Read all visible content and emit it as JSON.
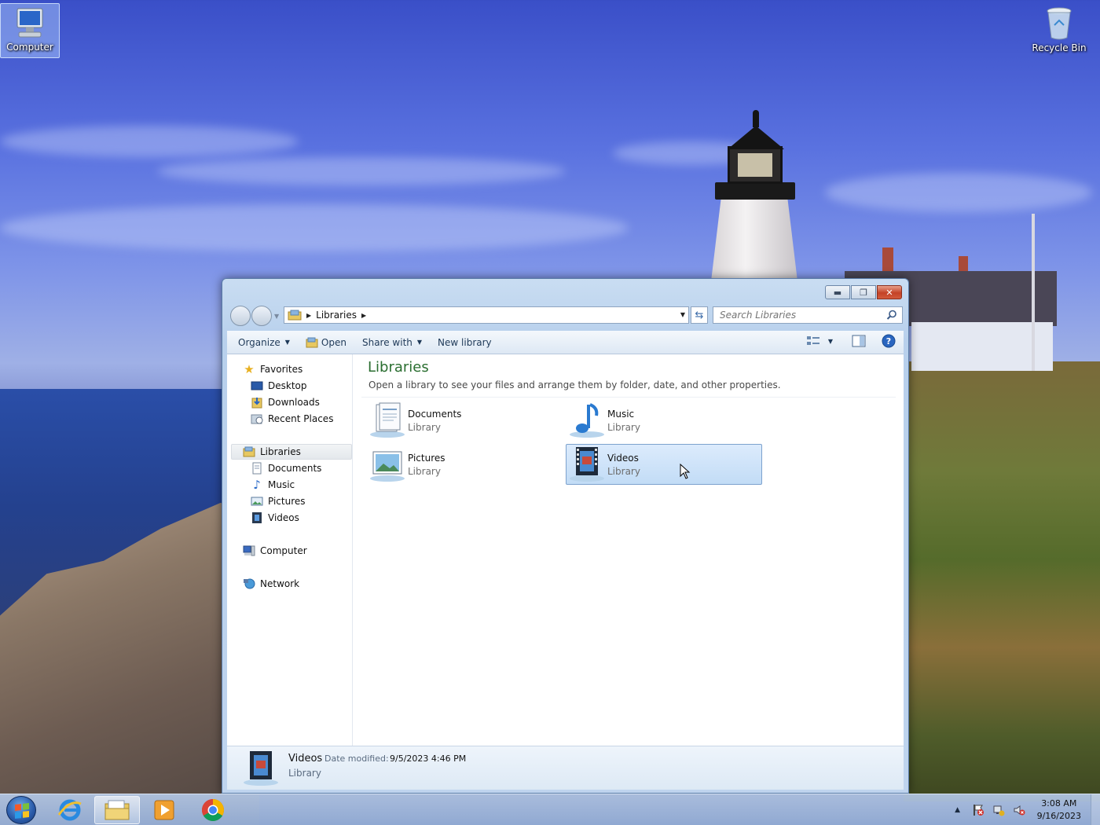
{
  "desktop": {
    "icons": [
      {
        "label": "Computer",
        "icon": "computer-icon"
      },
      {
        "label": "Recycle Bin",
        "icon": "recycle-bin-icon"
      }
    ]
  },
  "window": {
    "address": {
      "crumb": "Libraries"
    },
    "search": {
      "placeholder": "Search Libraries"
    },
    "toolbar": {
      "organize": "Organize",
      "open": "Open",
      "share_with": "Share with",
      "new_library": "New library"
    },
    "nav": {
      "favorites": "Favorites",
      "desktop": "Desktop",
      "downloads": "Downloads",
      "recent_places": "Recent Places",
      "libraries": "Libraries",
      "documents": "Documents",
      "music": "Music",
      "pictures": "Pictures",
      "videos": "Videos",
      "computer": "Computer",
      "network": "Network"
    },
    "main": {
      "title": "Libraries",
      "description": "Open a library to see your files and arrange them by folder, date, and other properties.",
      "tiles": [
        {
          "name": "Documents",
          "sub": "Library"
        },
        {
          "name": "Music",
          "sub": "Library"
        },
        {
          "name": "Pictures",
          "sub": "Library"
        },
        {
          "name": "Videos",
          "sub": "Library"
        }
      ]
    },
    "details": {
      "name": "Videos",
      "modified_label": "Date modified:",
      "modified_value": "9/5/2023 4:46 PM",
      "sub": "Library"
    }
  },
  "taskbar": {
    "time": "3:08 AM",
    "date": "9/16/2023"
  },
  "colors": {
    "title_green": "#2a6e30",
    "selection_blue": "#c2dcf6",
    "close_red": "#c44226"
  }
}
